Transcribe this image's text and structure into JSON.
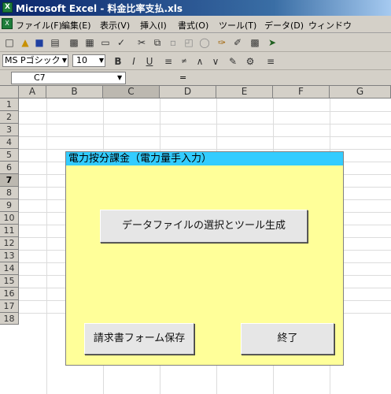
{
  "window": {
    "title": "Microsoft Excel - 料金比率支払.xls",
    "app_icon": "X"
  },
  "menubar": {
    "doc_icon": "X",
    "items": [
      "ファイル(F)",
      "編集(E)",
      "表示(V)",
      "挿入(I)",
      "書式(O)",
      "ツール(T)",
      "データ(D)",
      "ウィンドウ"
    ]
  },
  "standard_toolbar": {
    "icons": [
      "new-icon",
      "open-icon",
      "save-icon",
      "print-preview-icon",
      "print-icon",
      "preview-icon",
      "paste-special-icon",
      "spellcheck-icon",
      "cut-icon",
      "copy-icon",
      "paste-icon",
      "undo-icon",
      "redo-icon",
      "format-painter-icon",
      "drawing-icon",
      "chart-icon",
      "link-icon"
    ]
  },
  "format_toolbar": {
    "font_name": "MS Pゴシック",
    "font_size": "10",
    "bold": "B",
    "italic": "I",
    "underline": "U"
  },
  "formula_bar": {
    "cell_ref": "C7",
    "equals": "="
  },
  "columns": [
    "A",
    "B",
    "C",
    "D",
    "E",
    "F",
    "G"
  ],
  "rows": [
    "1",
    "2",
    "3",
    "4",
    "5",
    "6",
    "7",
    "8",
    "9",
    "10",
    "11",
    "12",
    "13",
    "14",
    "15",
    "16",
    "17",
    "18"
  ],
  "form": {
    "title": "電力按分課金（電力量手入力）",
    "select_data_button": "データファイルの選択とツール生成",
    "save_invoice_button": "請求書フォーム保存",
    "close_button": "終了"
  },
  "colors": {
    "form_bg": "#ffff99",
    "form_title_bg": "#33ccff",
    "title_bar": "#0a246a"
  }
}
